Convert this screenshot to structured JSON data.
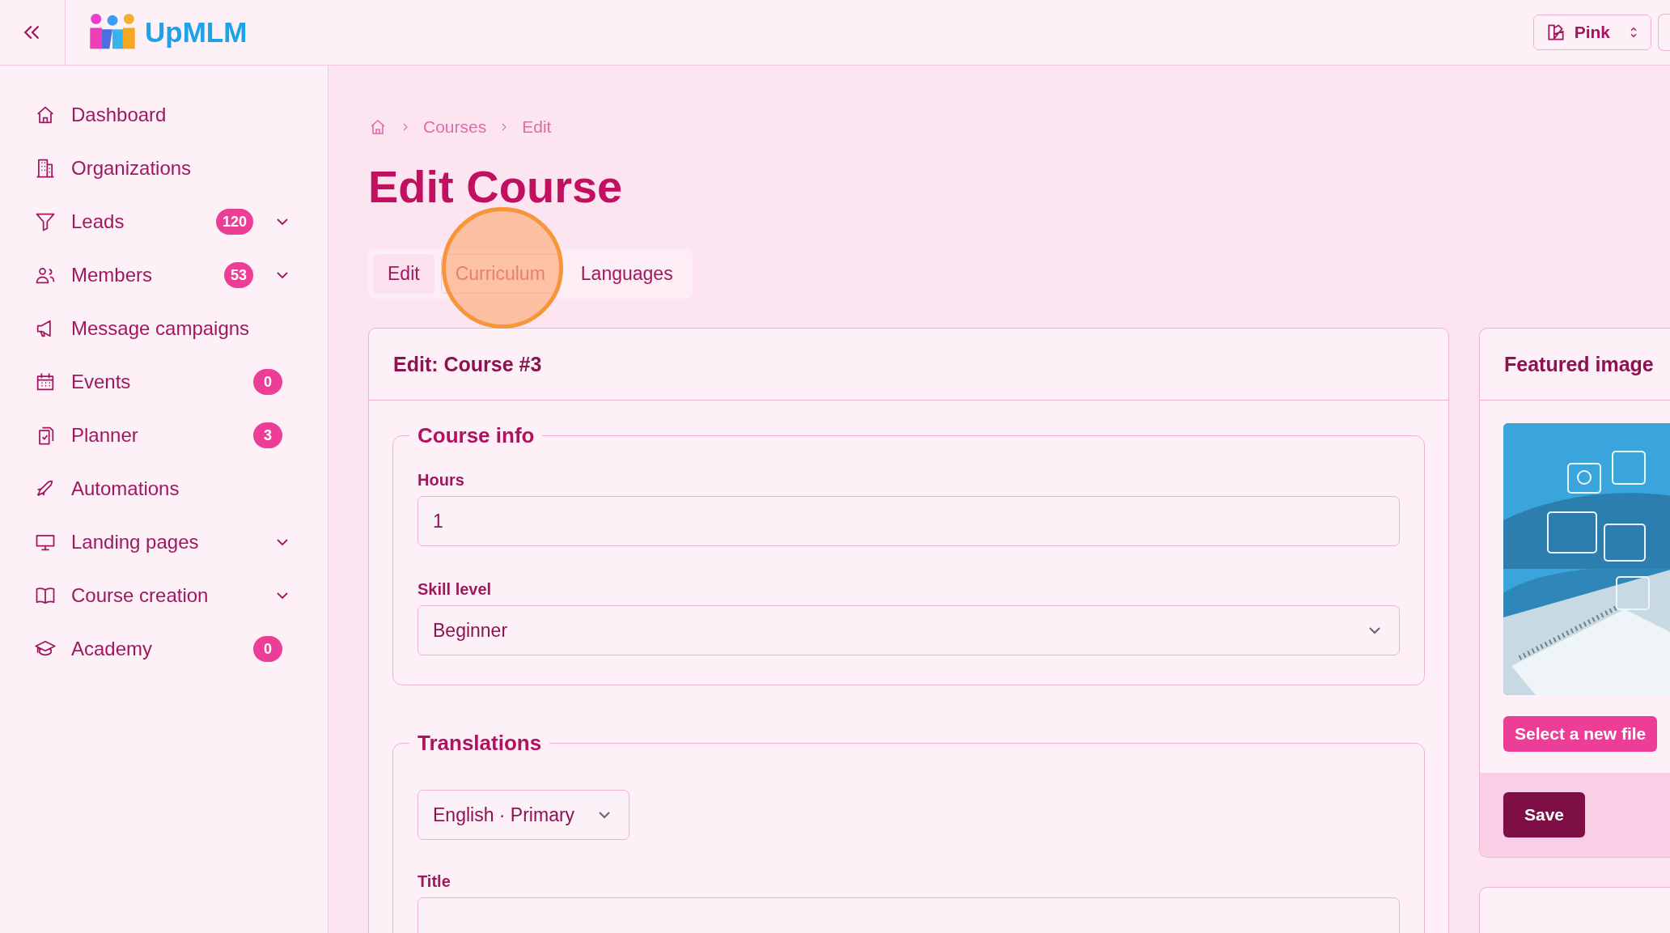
{
  "header": {
    "brand": "UpMLM",
    "theme_selector": "Pink"
  },
  "sidebar": {
    "items": [
      {
        "label": "Dashboard",
        "expandable": false
      },
      {
        "label": "Organizations",
        "expandable": false
      },
      {
        "label": "Leads",
        "badge": "120",
        "expandable": true
      },
      {
        "label": "Members",
        "badge": "53",
        "expandable": true
      },
      {
        "label": "Message campaigns",
        "expandable": false
      },
      {
        "label": "Events",
        "badge": "0",
        "expandable": false
      },
      {
        "label": "Planner",
        "badge": "3",
        "expandable": false
      },
      {
        "label": "Automations",
        "expandable": false
      },
      {
        "label": "Landing pages",
        "expandable": true
      },
      {
        "label": "Course creation",
        "expandable": true
      },
      {
        "label": "Academy",
        "badge": "0",
        "expandable": false
      }
    ]
  },
  "breadcrumb": [
    "Courses",
    "Edit"
  ],
  "title": "Edit Course",
  "tabs": [
    {
      "label": "Edit",
      "selected": true,
      "hovered": false
    },
    {
      "label": "Curriculum",
      "selected": false,
      "hovered": true
    },
    {
      "label": "Languages",
      "selected": false,
      "hovered": false
    }
  ],
  "click_marker": true,
  "card": {
    "title": "Edit: Course #3",
    "course_info": {
      "legend": "Course info",
      "fields": [
        {
          "label": "Hours",
          "kind": "input",
          "value": "1"
        },
        {
          "label": "Skill level",
          "kind": "select",
          "value": "Beginner"
        }
      ]
    },
    "translations": {
      "legend": "Translations",
      "language": "English · Primary",
      "fields": [
        {
          "label": "Title",
          "kind": "input"
        }
      ]
    }
  },
  "featured": {
    "title": "Featured image",
    "kind": "picture",
    "select_button": "Select a new file",
    "save_button": "Save"
  }
}
